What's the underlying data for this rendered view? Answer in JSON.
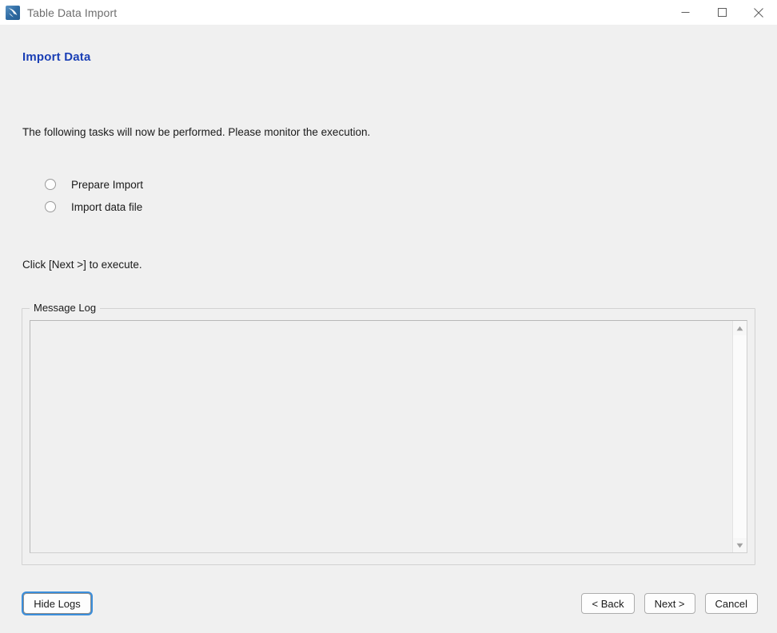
{
  "window": {
    "title": "Table Data Import",
    "icon": "workbench-dolphin-icon",
    "controls": {
      "minimize": "minimize-icon",
      "maximize": "maximize-icon",
      "close": "close-icon"
    }
  },
  "page": {
    "title": "Import Data",
    "title_color": "#1a3fb5",
    "intro": "The following tasks will now be performed. Please monitor the execution.",
    "execute_hint": "Click [Next >] to execute."
  },
  "tasks": [
    {
      "label": "Prepare Import",
      "status": "pending"
    },
    {
      "label": "Import data file",
      "status": "pending"
    }
  ],
  "message_log": {
    "legend": "Message Log",
    "content": "",
    "scrollbar": {
      "up_arrow": "scroll-up-icon",
      "down_arrow": "scroll-down-icon"
    }
  },
  "buttons": {
    "hide_logs": "Hide Logs",
    "back": "< Back",
    "next": "Next >",
    "cancel": "Cancel"
  }
}
